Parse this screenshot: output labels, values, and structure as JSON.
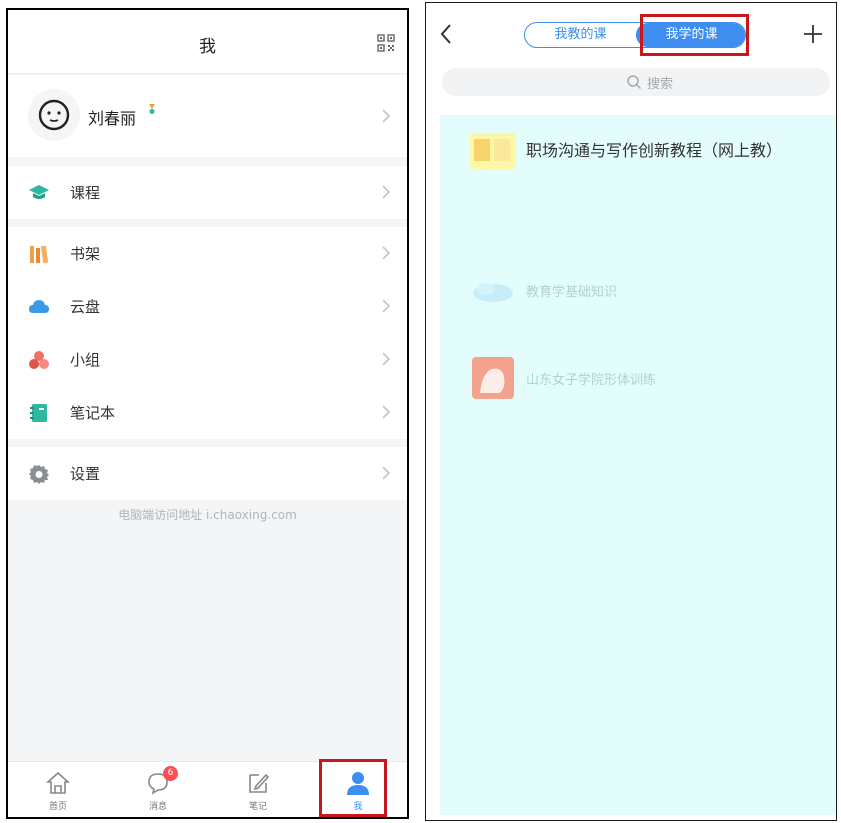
{
  "left": {
    "header": {
      "title": "我"
    },
    "profile": {
      "name": "刘春丽"
    },
    "menu": [
      {
        "label": "课程"
      },
      {
        "label": "书架"
      },
      {
        "label": "云盘"
      },
      {
        "label": "小组"
      },
      {
        "label": "笔记本"
      },
      {
        "label": "设置"
      }
    ],
    "footer_note": "电脑端访问地址 i.chaoxing.com",
    "tabs": [
      {
        "label": "首页"
      },
      {
        "label": "消息",
        "badge": "6"
      },
      {
        "label": "笔记"
      },
      {
        "label": "我"
      }
    ]
  },
  "right": {
    "segments": {
      "teaching": "我教的课",
      "learning": "我学的课"
    },
    "search": {
      "placeholder": "搜索"
    },
    "courses": [
      {
        "title": "职场沟通与写作创新教程（网上教）"
      },
      {
        "title": "教育学基础知识"
      },
      {
        "title": "山东女子学院形体训练"
      }
    ]
  },
  "colors": {
    "accent": "#3d8ef0",
    "highlight": "#c8161d",
    "badge": "#ff4d4f",
    "teal": "#2fb8a0",
    "cyan_overlay": "#e3fdfd"
  }
}
